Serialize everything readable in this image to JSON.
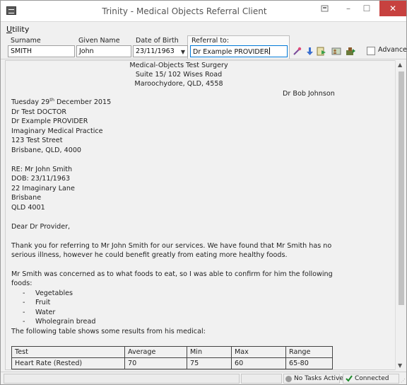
{
  "window": {
    "title": "Trinity - Medical Objects Referral Client",
    "min_glyph": "–",
    "max_glyph": "☐",
    "close_glyph": "✕"
  },
  "menu": {
    "utility_first": "U",
    "utility_rest": "tility"
  },
  "form": {
    "surname_label": "Surname",
    "surname_value": "SMITH",
    "given_label": "Given Name",
    "given_value": "John",
    "dob_label": "Date of Birth",
    "dob_value": "23/11/1963",
    "referral_label": "Referral to:",
    "referral_value": "Dr Example PROVIDER",
    "advanced_label": "Advanced"
  },
  "toolbar": {
    "icons": [
      "wand-icon",
      "download-icon",
      "export-icon",
      "contacts-icon",
      "send-icon"
    ]
  },
  "document": {
    "header": [
      "Medical-Objects Test Surgery",
      "Suite 15/ 102 Wises Road",
      "Maroochydore, QLD, 4558"
    ],
    "doctor": "Dr Bob Johnson",
    "date_pre": "Tuesday 29",
    "date_sup": "th",
    "date_post": " December 2015",
    "address": [
      "Dr Test DOCTOR",
      "Dr Example PROVIDER",
      "Imaginary Medical Practice",
      "123 Test Street",
      "Brisbane, QLD, 4000"
    ],
    "re": [
      "RE: Mr John Smith",
      "DOB: 23/11/1963",
      "22 Imaginary Lane",
      "Brisbane",
      "QLD 4001"
    ],
    "salutation": "Dear Dr Provider,",
    "para1": [
      "Thank you for referring to Mr John Smith for our services. We have found that Mr Smith has no",
      "serious illness, however he could benefit greatly from eating more healthy foods."
    ],
    "para2": [
      "Mr Smith was concerned as to what foods to eat, so I was able to confirm for him the following",
      "foods:"
    ],
    "foods": [
      "Vegetables",
      "Fruit",
      "Water",
      "Wholegrain bread"
    ],
    "bullet": "-",
    "table_intro": "The following table shows some results from his medical:",
    "table": {
      "headers": [
        "Test",
        "Average",
        "Min",
        "Max",
        "Range"
      ],
      "rows": [
        [
          "Heart Rate (Rested)",
          "70",
          "75",
          "60",
          "65-80"
        ]
      ]
    }
  },
  "status": {
    "tasks": "No Tasks Active",
    "connection": "Connected"
  }
}
